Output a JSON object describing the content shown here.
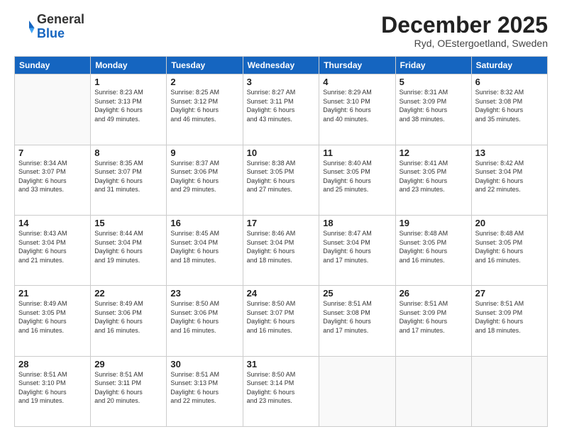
{
  "header": {
    "logo": {
      "general": "General",
      "blue": "Blue"
    },
    "title": "December 2025",
    "location": "Ryd, OEstergoetland, Sweden"
  },
  "days_of_week": [
    "Sunday",
    "Monday",
    "Tuesday",
    "Wednesday",
    "Thursday",
    "Friday",
    "Saturday"
  ],
  "weeks": [
    [
      {
        "day": "",
        "info": ""
      },
      {
        "day": "1",
        "info": "Sunrise: 8:23 AM\nSunset: 3:13 PM\nDaylight: 6 hours\nand 49 minutes."
      },
      {
        "day": "2",
        "info": "Sunrise: 8:25 AM\nSunset: 3:12 PM\nDaylight: 6 hours\nand 46 minutes."
      },
      {
        "day": "3",
        "info": "Sunrise: 8:27 AM\nSunset: 3:11 PM\nDaylight: 6 hours\nand 43 minutes."
      },
      {
        "day": "4",
        "info": "Sunrise: 8:29 AM\nSunset: 3:10 PM\nDaylight: 6 hours\nand 40 minutes."
      },
      {
        "day": "5",
        "info": "Sunrise: 8:31 AM\nSunset: 3:09 PM\nDaylight: 6 hours\nand 38 minutes."
      },
      {
        "day": "6",
        "info": "Sunrise: 8:32 AM\nSunset: 3:08 PM\nDaylight: 6 hours\nand 35 minutes."
      }
    ],
    [
      {
        "day": "7",
        "info": "Sunrise: 8:34 AM\nSunset: 3:07 PM\nDaylight: 6 hours\nand 33 minutes."
      },
      {
        "day": "8",
        "info": "Sunrise: 8:35 AM\nSunset: 3:07 PM\nDaylight: 6 hours\nand 31 minutes."
      },
      {
        "day": "9",
        "info": "Sunrise: 8:37 AM\nSunset: 3:06 PM\nDaylight: 6 hours\nand 29 minutes."
      },
      {
        "day": "10",
        "info": "Sunrise: 8:38 AM\nSunset: 3:05 PM\nDaylight: 6 hours\nand 27 minutes."
      },
      {
        "day": "11",
        "info": "Sunrise: 8:40 AM\nSunset: 3:05 PM\nDaylight: 6 hours\nand 25 minutes."
      },
      {
        "day": "12",
        "info": "Sunrise: 8:41 AM\nSunset: 3:05 PM\nDaylight: 6 hours\nand 23 minutes."
      },
      {
        "day": "13",
        "info": "Sunrise: 8:42 AM\nSunset: 3:04 PM\nDaylight: 6 hours\nand 22 minutes."
      }
    ],
    [
      {
        "day": "14",
        "info": "Sunrise: 8:43 AM\nSunset: 3:04 PM\nDaylight: 6 hours\nand 21 minutes."
      },
      {
        "day": "15",
        "info": "Sunrise: 8:44 AM\nSunset: 3:04 PM\nDaylight: 6 hours\nand 19 minutes."
      },
      {
        "day": "16",
        "info": "Sunrise: 8:45 AM\nSunset: 3:04 PM\nDaylight: 6 hours\nand 18 minutes."
      },
      {
        "day": "17",
        "info": "Sunrise: 8:46 AM\nSunset: 3:04 PM\nDaylight: 6 hours\nand 18 minutes."
      },
      {
        "day": "18",
        "info": "Sunrise: 8:47 AM\nSunset: 3:04 PM\nDaylight: 6 hours\nand 17 minutes."
      },
      {
        "day": "19",
        "info": "Sunrise: 8:48 AM\nSunset: 3:05 PM\nDaylight: 6 hours\nand 16 minutes."
      },
      {
        "day": "20",
        "info": "Sunrise: 8:48 AM\nSunset: 3:05 PM\nDaylight: 6 hours\nand 16 minutes."
      }
    ],
    [
      {
        "day": "21",
        "info": "Sunrise: 8:49 AM\nSunset: 3:05 PM\nDaylight: 6 hours\nand 16 minutes."
      },
      {
        "day": "22",
        "info": "Sunrise: 8:49 AM\nSunset: 3:06 PM\nDaylight: 6 hours\nand 16 minutes."
      },
      {
        "day": "23",
        "info": "Sunrise: 8:50 AM\nSunset: 3:06 PM\nDaylight: 6 hours\nand 16 minutes."
      },
      {
        "day": "24",
        "info": "Sunrise: 8:50 AM\nSunset: 3:07 PM\nDaylight: 6 hours\nand 16 minutes."
      },
      {
        "day": "25",
        "info": "Sunrise: 8:51 AM\nSunset: 3:08 PM\nDaylight: 6 hours\nand 17 minutes."
      },
      {
        "day": "26",
        "info": "Sunrise: 8:51 AM\nSunset: 3:09 PM\nDaylight: 6 hours\nand 17 minutes."
      },
      {
        "day": "27",
        "info": "Sunrise: 8:51 AM\nSunset: 3:09 PM\nDaylight: 6 hours\nand 18 minutes."
      }
    ],
    [
      {
        "day": "28",
        "info": "Sunrise: 8:51 AM\nSunset: 3:10 PM\nDaylight: 6 hours\nand 19 minutes."
      },
      {
        "day": "29",
        "info": "Sunrise: 8:51 AM\nSunset: 3:11 PM\nDaylight: 6 hours\nand 20 minutes."
      },
      {
        "day": "30",
        "info": "Sunrise: 8:51 AM\nSunset: 3:13 PM\nDaylight: 6 hours\nand 22 minutes."
      },
      {
        "day": "31",
        "info": "Sunrise: 8:50 AM\nSunset: 3:14 PM\nDaylight: 6 hours\nand 23 minutes."
      },
      {
        "day": "",
        "info": ""
      },
      {
        "day": "",
        "info": ""
      },
      {
        "day": "",
        "info": ""
      }
    ]
  ]
}
